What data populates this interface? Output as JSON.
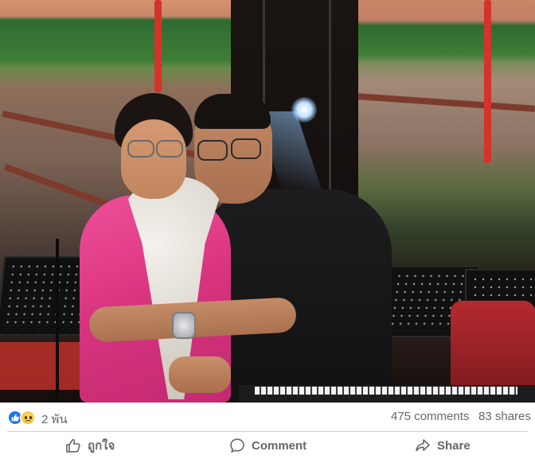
{
  "post": {
    "photo": {
      "icon": "post-photo"
    },
    "stats": {
      "reactions": {
        "icons": [
          "like-icon",
          "sad-icon"
        ],
        "count": "2 พัน"
      },
      "comments": "475 comments",
      "shares": "83 shares"
    },
    "actions": {
      "like_label": "ถูกใจ",
      "comment_label": "Comment",
      "share_label": "Share"
    }
  },
  "colors": {
    "like_blue": "#1877f2",
    "secondary_text": "#65676b",
    "divider": "#ced0d4"
  }
}
